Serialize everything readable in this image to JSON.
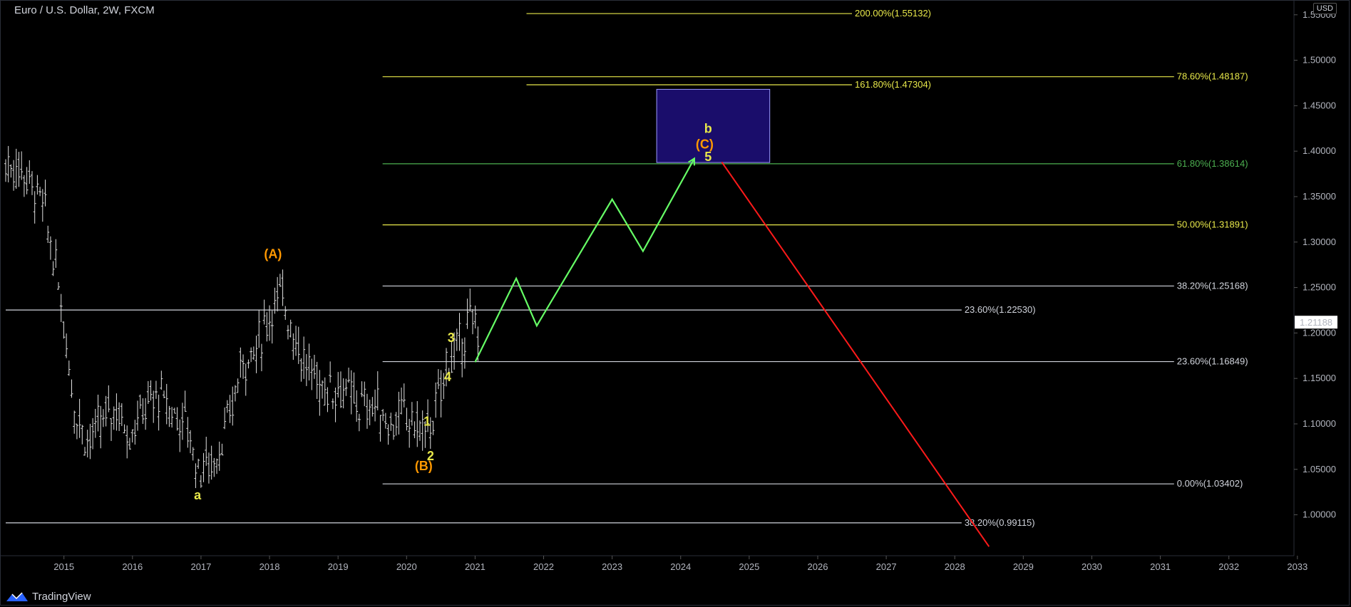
{
  "header": {
    "title": "Euro / U.S. Dollar, 2W, FXCM",
    "currency": "USD"
  },
  "footer": {
    "brand": "TradingView"
  },
  "colors": {
    "background": "#000000",
    "white_line": "#d1d4dc",
    "yellow": "#e8e84a",
    "green": "#4caf50",
    "wave_green": "#66ff66",
    "red": "#ff1a1a",
    "orange": "#ff9800",
    "box": "#1a0d6b"
  },
  "chart_data": {
    "type": "candlestick",
    "yaxis": {
      "min": 0.955,
      "max": 1.56,
      "ticks": [
        "1.00000",
        "1.05000",
        "1.10000",
        "1.15000",
        "1.20000",
        "1.25000",
        "1.30000",
        "1.35000",
        "1.40000",
        "1.45000",
        "1.50000",
        "1.55000"
      ],
      "tick_values": [
        1.0,
        1.05,
        1.1,
        1.15,
        1.2,
        1.25,
        1.3,
        1.35,
        1.4,
        1.45,
        1.5,
        1.55
      ]
    },
    "xaxis": {
      "min": 2014.15,
      "max": 2032.95,
      "ticks": [
        "2015",
        "2016",
        "2017",
        "2018",
        "2019",
        "2020",
        "2021",
        "2022",
        "2023",
        "2024",
        "2025",
        "2026",
        "2027",
        "2028",
        "2029",
        "2030",
        "2031",
        "2032",
        "2033"
      ],
      "tick_values": [
        2015,
        2016,
        2017,
        2018,
        2019,
        2020,
        2021,
        2022,
        2023,
        2024,
        2025,
        2026,
        2027,
        2028,
        2029,
        2030,
        2031,
        2032,
        2033
      ]
    },
    "last_price": {
      "value": 1.21188,
      "label": "1.21188"
    },
    "price_anchors": [
      [
        2014.15,
        1.385
      ],
      [
        2014.4,
        1.38
      ],
      [
        2014.7,
        1.34
      ],
      [
        2014.95,
        1.24
      ],
      [
        2015.15,
        1.12
      ],
      [
        2015.35,
        1.08
      ],
      [
        2015.55,
        1.1
      ],
      [
        2015.75,
        1.12
      ],
      [
        2015.95,
        1.09
      ],
      [
        2016.2,
        1.12
      ],
      [
        2016.4,
        1.13
      ],
      [
        2016.6,
        1.11
      ],
      [
        2016.8,
        1.1
      ],
      [
        2016.95,
        1.05
      ],
      [
        2017.2,
        1.06
      ],
      [
        2017.4,
        1.1
      ],
      [
        2017.6,
        1.17
      ],
      [
        2017.8,
        1.18
      ],
      [
        2018.05,
        1.23
      ],
      [
        2018.2,
        1.24
      ],
      [
        2018.35,
        1.2
      ],
      [
        2018.55,
        1.16
      ],
      [
        2018.8,
        1.14
      ],
      [
        2019.05,
        1.14
      ],
      [
        2019.3,
        1.12
      ],
      [
        2019.55,
        1.12
      ],
      [
        2019.75,
        1.1
      ],
      [
        2019.95,
        1.11
      ],
      [
        2020.1,
        1.1
      ],
      [
        2020.3,
        1.09
      ],
      [
        2020.45,
        1.12
      ],
      [
        2020.6,
        1.17
      ],
      [
        2020.75,
        1.18
      ],
      [
        2020.9,
        1.21
      ],
      [
        2021.05,
        1.21
      ]
    ],
    "fib_levels": [
      {
        "label": "200.00%(1.55132)",
        "value": 1.55132,
        "color": "yellow",
        "x_start": 2021.75,
        "x_end": 2026.5,
        "label_x": 2026.5
      },
      {
        "label": "161.80%(1.47304)",
        "value": 1.47304,
        "color": "yellow",
        "x_start": 2021.75,
        "x_end": 2026.5,
        "label_x": 2026.5
      },
      {
        "label": "78.60%(1.48187)",
        "value": 1.48187,
        "color": "yellow",
        "x_start": 2019.65,
        "x_end": 2031.2,
        "label_x": 2031.2
      },
      {
        "label": "61.80%(1.38614)",
        "value": 1.38614,
        "color": "green",
        "x_start": 2019.65,
        "x_end": 2031.2,
        "label_x": 2031.2
      },
      {
        "label": "50.00%(1.31891)",
        "value": 1.31891,
        "color": "yellow",
        "x_start": 2019.65,
        "x_end": 2031.2,
        "label_x": 2031.2
      },
      {
        "label": "38.20%(1.25168)",
        "value": 1.25168,
        "color": "white",
        "x_start": 2019.65,
        "x_end": 2031.2,
        "label_x": 2031.2
      },
      {
        "label": "23.60%(1.22530)",
        "value": 1.2253,
        "color": "white",
        "x_start": 2014.15,
        "x_end": 2028.1,
        "label_x": 2028.1
      },
      {
        "label": "23.60%(1.16849)",
        "value": 1.16849,
        "color": "white",
        "x_start": 2019.65,
        "x_end": 2031.2,
        "label_x": 2031.2
      },
      {
        "label": "0.00%(1.03402)",
        "value": 1.03402,
        "color": "white",
        "x_start": 2019.65,
        "x_end": 2031.2,
        "label_x": 2031.2
      },
      {
        "label": "38.20%(0.99115)",
        "value": 0.99115,
        "color": "white",
        "x_start": 2014.15,
        "x_end": 2028.1,
        "label_x": 2028.1
      }
    ],
    "target_box": {
      "x1": 2023.65,
      "x2": 2025.3,
      "y1": 1.3875,
      "y2": 1.468
    },
    "projection_path": [
      [
        2021.0,
        1.168
      ],
      [
        2021.6,
        1.26
      ],
      [
        2021.9,
        1.208
      ],
      [
        2023.0,
        1.347
      ],
      [
        2023.45,
        1.29
      ],
      [
        2024.2,
        1.392
      ]
    ],
    "decline_path": [
      [
        2024.6,
        1.388
      ],
      [
        2028.5,
        0.965
      ]
    ],
    "wave_labels": [
      {
        "text": "(A)",
        "x": 2018.05,
        "y": 1.282,
        "color": "orange",
        "bold": false
      },
      {
        "text": "(B)",
        "x": 2020.25,
        "y": 1.049,
        "color": "orange",
        "bold": false
      },
      {
        "text": "a",
        "x": 2016.95,
        "y": 1.017,
        "color": "yellow",
        "bold": true
      },
      {
        "text": "1",
        "x": 2020.3,
        "y": 1.098,
        "color": "yellow",
        "bold": true
      },
      {
        "text": "2",
        "x": 2020.35,
        "y": 1.06,
        "color": "yellow",
        "bold": true
      },
      {
        "text": "3",
        "x": 2020.65,
        "y": 1.19,
        "color": "yellow",
        "bold": true
      },
      {
        "text": "4",
        "x": 2020.6,
        "y": 1.147,
        "color": "yellow",
        "bold": true
      },
      {
        "text": "(C)",
        "x": 2024.35,
        "y": 1.403,
        "color": "orange",
        "bold": false
      },
      {
        "text": "5",
        "x": 2024.4,
        "y": 1.389,
        "color": "yellow",
        "bold": true
      },
      {
        "text": "b",
        "x": 2024.4,
        "y": 1.42,
        "color": "yellow",
        "bold": true
      }
    ]
  }
}
